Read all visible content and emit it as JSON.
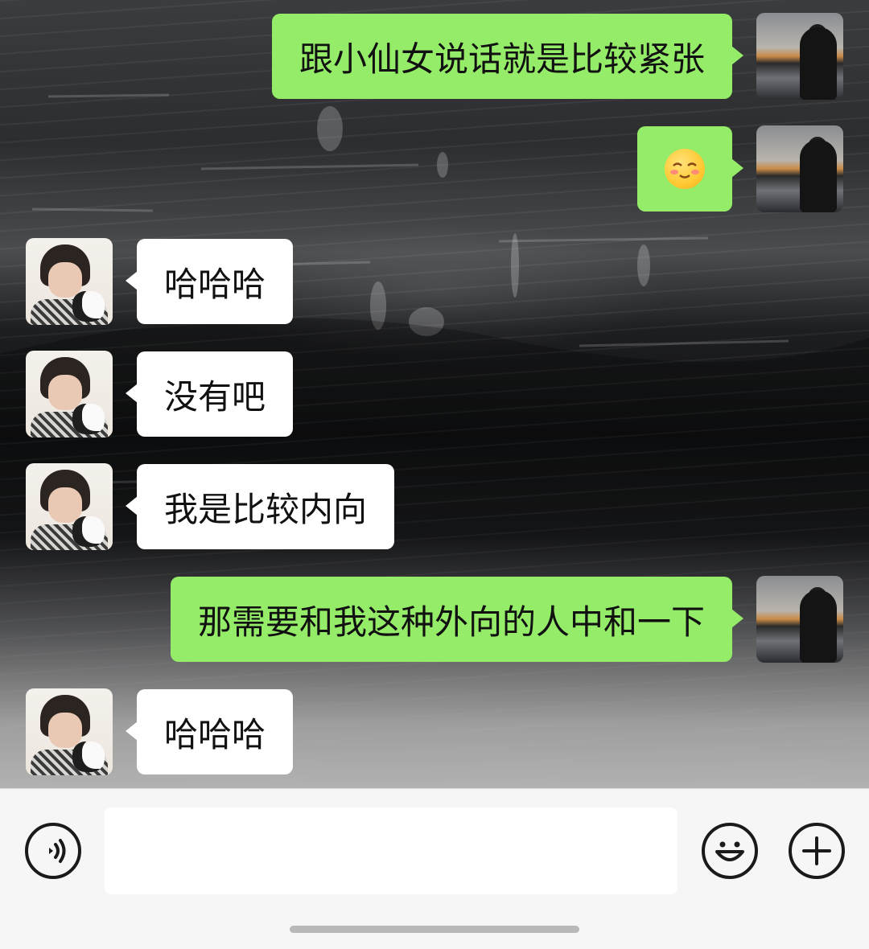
{
  "chat": {
    "messages": [
      {
        "side": "me",
        "type": "text",
        "text": "跟小仙女说话就是比较紧张"
      },
      {
        "side": "me",
        "type": "emoji",
        "emoji": "shy-smile-emoji"
      },
      {
        "side": "other",
        "type": "text",
        "text": "哈哈哈"
      },
      {
        "side": "other",
        "type": "text",
        "text": "没有吧"
      },
      {
        "side": "other",
        "type": "text",
        "text": "我是比较内向"
      },
      {
        "side": "me",
        "type": "text",
        "text": "那需要和我这种外向的人中和一下"
      },
      {
        "side": "other",
        "type": "text",
        "text": "哈哈哈"
      }
    ]
  },
  "input_bar": {
    "text_value": "",
    "voice_icon": "voice-icon",
    "emoji_icon": "emoji-icon",
    "plus_icon": "plus-icon"
  },
  "colors": {
    "my_bubble": "#95ec69",
    "other_bubble": "#ffffff",
    "input_bar_bg": "#f6f6f6"
  }
}
